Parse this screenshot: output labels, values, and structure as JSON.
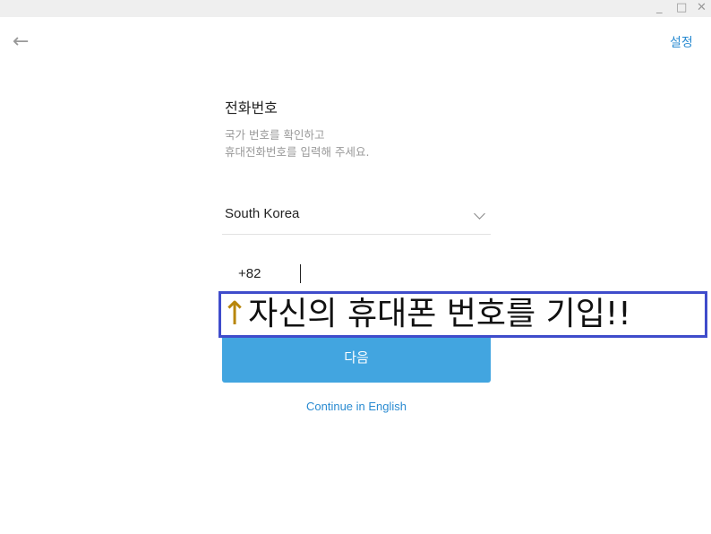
{
  "window": {
    "minimize": "_",
    "maximize": "□",
    "close": "✕"
  },
  "header": {
    "back_icon": "arrow-left",
    "settings_label": "설정"
  },
  "form": {
    "title": "전화번호",
    "desc_line1": "국가 번호를 확인하고",
    "desc_line2": "휴대전화번호를 입력해 주세요.",
    "country": "South Korea",
    "country_code": "+82",
    "phone_value": "",
    "next_label": "다음",
    "english_link": "Continue in English"
  },
  "annotation": {
    "arrow": "↑",
    "text": "자신의 휴대폰 번호를 기입!!"
  }
}
